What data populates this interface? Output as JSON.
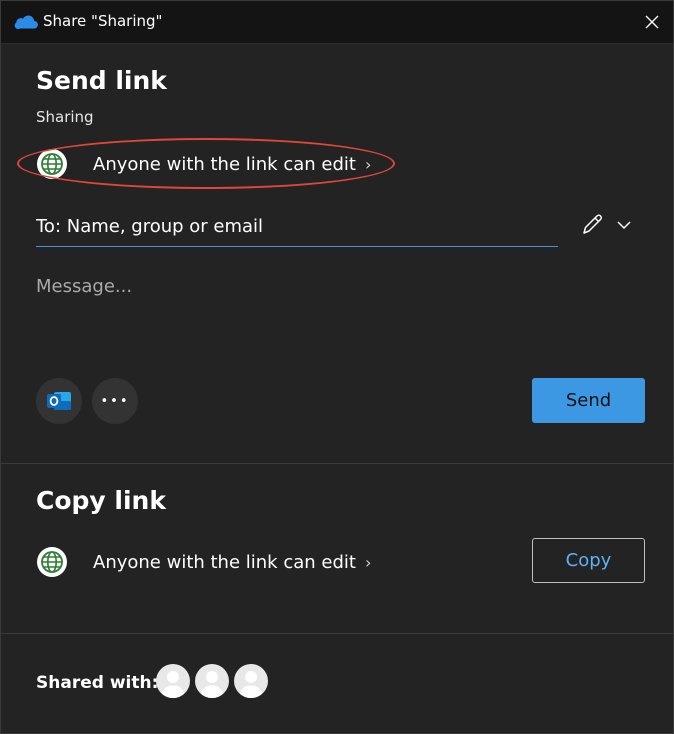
{
  "window": {
    "title": "Share \"Sharing\"",
    "close_icon": "close-icon",
    "app_icon": "onedrive-cloud-icon"
  },
  "send_link": {
    "heading": "Send link",
    "item_name": "Sharing",
    "permission_text": "Anyone with the link can edit",
    "permission_chevron": "›",
    "to_placeholder": "To: Name, group or email",
    "message_placeholder": "Message...",
    "send_label": "Send",
    "more_label": "•••"
  },
  "copy_link": {
    "heading": "Copy link",
    "permission_text": "Anyone with the link can edit",
    "permission_chevron": "›",
    "copy_label": "Copy"
  },
  "shared_with": {
    "label": "Shared with:",
    "avatar_count": 3
  },
  "colors": {
    "accent": "#3d98e4",
    "link_text": "#5eb1f5",
    "globe": "#2e7d32",
    "highlight": "#e0473a",
    "outlook_blue": "#0f6cbd"
  }
}
